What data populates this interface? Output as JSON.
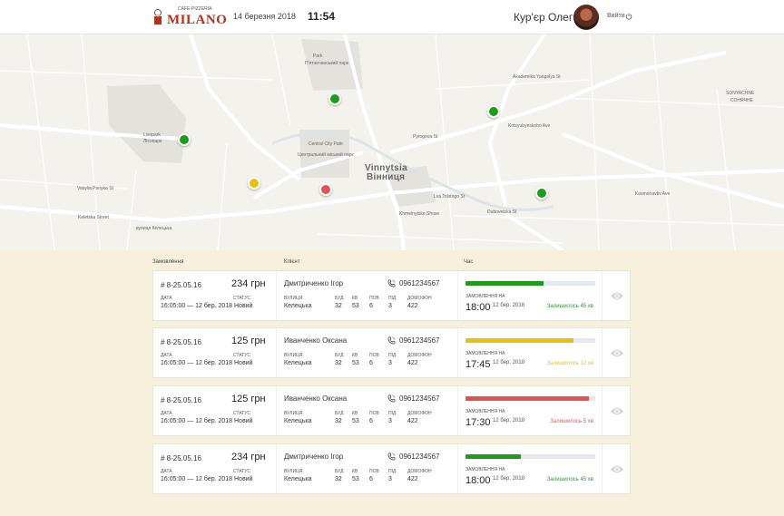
{
  "header": {
    "logo_text": "MILANO",
    "logo_subtext": "CAFE-PIZZERIA",
    "date": "14 березня 2018",
    "time": "11:54",
    "courier_name": "Кур'єр Олег",
    "logout_label": "Вийти",
    "logout_icon": "power-icon"
  },
  "map": {
    "city_label_en": "Vinnytsia",
    "city_label_uk": "Вінниця",
    "labels": {
      "park": "Park",
      "park_uk": "П'ятничанський парк",
      "lisopark": "Lisopark",
      "lisopark_uk": "Лісопарк",
      "central_park": "Central City Park",
      "central_park_uk": "Центральний міський парк",
      "sonyachne": "SONYACHNE",
      "sonyachne_uk": "СОНЯЧНЕ",
      "keletska": "Keletska Street",
      "keletska_uk": "вулиця Келецька",
      "pyrogova": "Pyrogova St",
      "kotsyubynskoho": "Kotsyubynskoho Ave",
      "akademika": "Akademika Yangelya St",
      "vasylia": "Vasylia Poriyka St",
      "kosmonavtiv": "Kosmonavtiv Ave",
      "khmelnytske": "Khmelnytske Shose",
      "dubovetska": "Dubovetska St",
      "lva": "Lva Tolstogo St"
    },
    "pins": [
      {
        "status": "green",
        "color": "#1e9a1e"
      },
      {
        "status": "green",
        "color": "#1e9a1e"
      },
      {
        "status": "green",
        "color": "#1e9a1e"
      },
      {
        "status": "yellow",
        "color": "#e8c10f"
      },
      {
        "status": "red",
        "color": "#e05453"
      },
      {
        "status": "green",
        "color": "#1e9a1e"
      }
    ]
  },
  "list": {
    "col_order": "Замовлення",
    "col_client": "Клієнт",
    "col_time": "Час"
  },
  "labels": {
    "date": "ДАТА",
    "status": "СТАТУС",
    "street": "ВУЛИЦЯ",
    "building": "БУД",
    "apt": "КВ",
    "floor": "ПОВ",
    "entrance": "ПІД",
    "intercom": "ДОМОФОН",
    "ordered_at": "ЗАМОВЛЕННЯ НА"
  },
  "orders": [
    {
      "number": "# 8-25.05.16",
      "price": "234 грн",
      "date": "16:05:00 — 12 бер. 2018",
      "status": "Новий",
      "client": "Дмитриченко Ігор",
      "phone": "0961234567",
      "street": "Келецька",
      "building": "32",
      "apt": "53",
      "floor": "6",
      "entrance": "3",
      "intercom": "422",
      "time": "18:00",
      "day": "12 бер. 2018",
      "remaining": "Залишилось 45 хв",
      "progress": 0.6,
      "color": "#1e9a1e"
    },
    {
      "number": "# 8-25.05.16",
      "price": "125 грн",
      "date": "16:05:00 — 12 бер. 2018",
      "status": "Новий",
      "client": "Иванченко Оксана",
      "phone": "0961234567",
      "street": "Келецька",
      "building": "32",
      "apt": "53",
      "floor": "6",
      "entrance": "3",
      "intercom": "422",
      "time": "17:45",
      "day": "12 бер. 2018",
      "remaining": "Залишилось 12 хв",
      "progress": 0.83,
      "color": "#e8c10f"
    },
    {
      "number": "# 8-25.05.16",
      "price": "125 грн",
      "date": "16:05:00 — 12 бер. 2018",
      "status": "Новий",
      "client": "Иванченко Оксана",
      "phone": "0961234567",
      "street": "Келецька",
      "building": "32",
      "apt": "53",
      "floor": "6",
      "entrance": "3",
      "intercom": "422",
      "time": "17:30",
      "day": "12 бер. 2018",
      "remaining": "Залишилось 5 хв",
      "progress": 0.95,
      "color": "#e05453"
    },
    {
      "number": "# 8-25.05.16",
      "price": "234 грн",
      "date": "16:05:00 — 12 бер. 2018",
      "status": "Новий",
      "client": "Дмитриченко Ігор",
      "phone": "0961234567",
      "street": "Келецька",
      "building": "32",
      "apt": "53",
      "floor": "6",
      "entrance": "3",
      "intercom": "422",
      "time": "18:00",
      "day": "12 бер. 2018",
      "remaining": "Залишилось 45 хв",
      "progress": 0.43,
      "color": "#1e9a1e"
    }
  ]
}
